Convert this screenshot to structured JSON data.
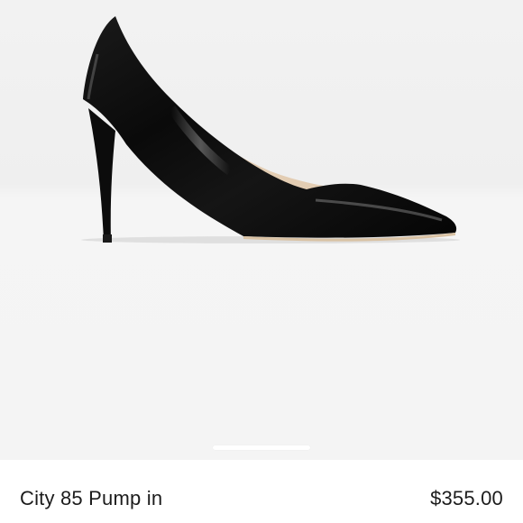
{
  "listing": {
    "title": "City 85 Pump in",
    "price": "$355.00"
  },
  "gallery": {
    "pages": 1,
    "current_page": 1
  },
  "colors": {
    "shoe": "#0c0c0c",
    "lining": "#e3cdb3",
    "background": "#f2f2f2"
  }
}
